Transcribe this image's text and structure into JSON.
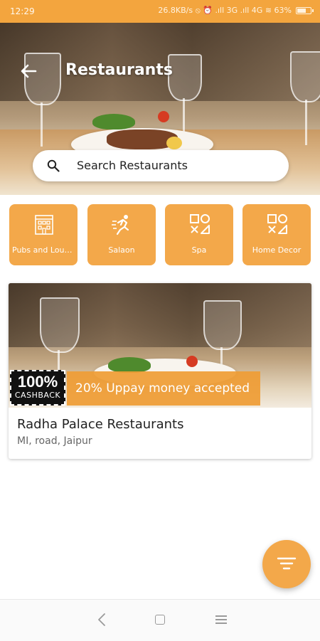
{
  "status_bar": {
    "time": "12:29",
    "indicators": "26.8KB/s ⦸ ⏰ .ıll 3G .ıll 4G ≋ 63%"
  },
  "header": {
    "title": "Restaurants",
    "back_icon": "arrow-left-icon"
  },
  "search": {
    "placeholder": "Search Restaurants",
    "icon": "search-icon"
  },
  "categories": [
    {
      "label": "Pubs and Lounges",
      "icon": "building-icon"
    },
    {
      "label": "Salaon",
      "icon": "runner-icon"
    },
    {
      "label": "Spa",
      "icon": "shapes-icon"
    },
    {
      "label": "Home Decor",
      "icon": "shapes-icon"
    }
  ],
  "listing": {
    "cashback_percent": "100%",
    "cashback_label": "CASHBACK",
    "offer": "20% Uppay money accepted",
    "name": "Radha Palace Restaurants",
    "address": "MI, road, Jaipur"
  },
  "fab": {
    "icon": "filter-icon"
  },
  "colors": {
    "accent": "#f3a53e",
    "card_accent": "#f3a84a"
  }
}
